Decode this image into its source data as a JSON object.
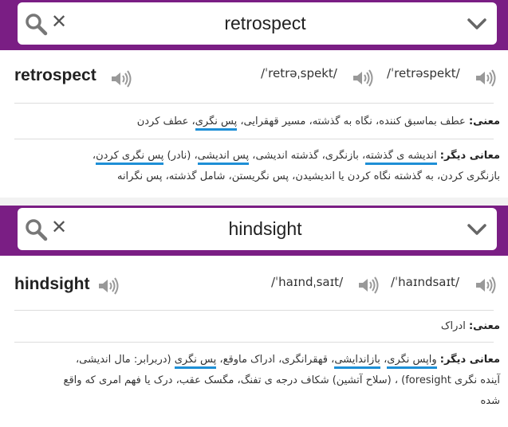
{
  "entries": [
    {
      "search_query": "retrospect",
      "word": "retrospect",
      "pron1": "/ˈretrəˌspekt/",
      "pron2": "/ˈretrəspekt/",
      "meaning_label": "معنی:",
      "meaning_plain": "عطف بماسبق کننده، نگاه به گذشته، مسیر قهقرایی،",
      "meaning_ul": "پس نگری",
      "meaning_tail": "، عطف کردن",
      "other_label": "معانی دیگر:",
      "other_ul1": "اندیشه ی گذشته",
      "other_t1": "، بازنگری، گذشته اندیشی،",
      "other_ul2": "پس اندیشی",
      "other_t2": "، (نادر)",
      "other_ul3": "پس نگری کردن",
      "other_t3": "،",
      "other_line2": "بازنگری کردن، به گذشته نگاه کردن یا اندیشیدن، پس نگریستن، شامل گذشته، پس نگرانه"
    },
    {
      "search_query": "hindsight",
      "word": "hindsight",
      "pron1": "/ˈhaɪndˌsaɪt/",
      "pron2": "/ˈhaɪndsaɪt/",
      "meaning_label": "معنی:",
      "meaning_plain": "ادراک",
      "other_label": "معانی دیگر:",
      "other_ul1": "واپس نگری",
      "other_t1": "،",
      "other_ul2": "بازاندایشی",
      "other_t2": "، قهقرانگری، ادراک ماوقع،",
      "other_ul3": "پس نگری",
      "other_t3": " (دربرابر: مال اندیشی،",
      "other_line2": "آینده نگری foresight) ، (سلاح آتشین) شکاف درجه ی تفنگ، مگسک عقب، درک یا فهم امری که واقع",
      "other_line3": "شده"
    }
  ]
}
